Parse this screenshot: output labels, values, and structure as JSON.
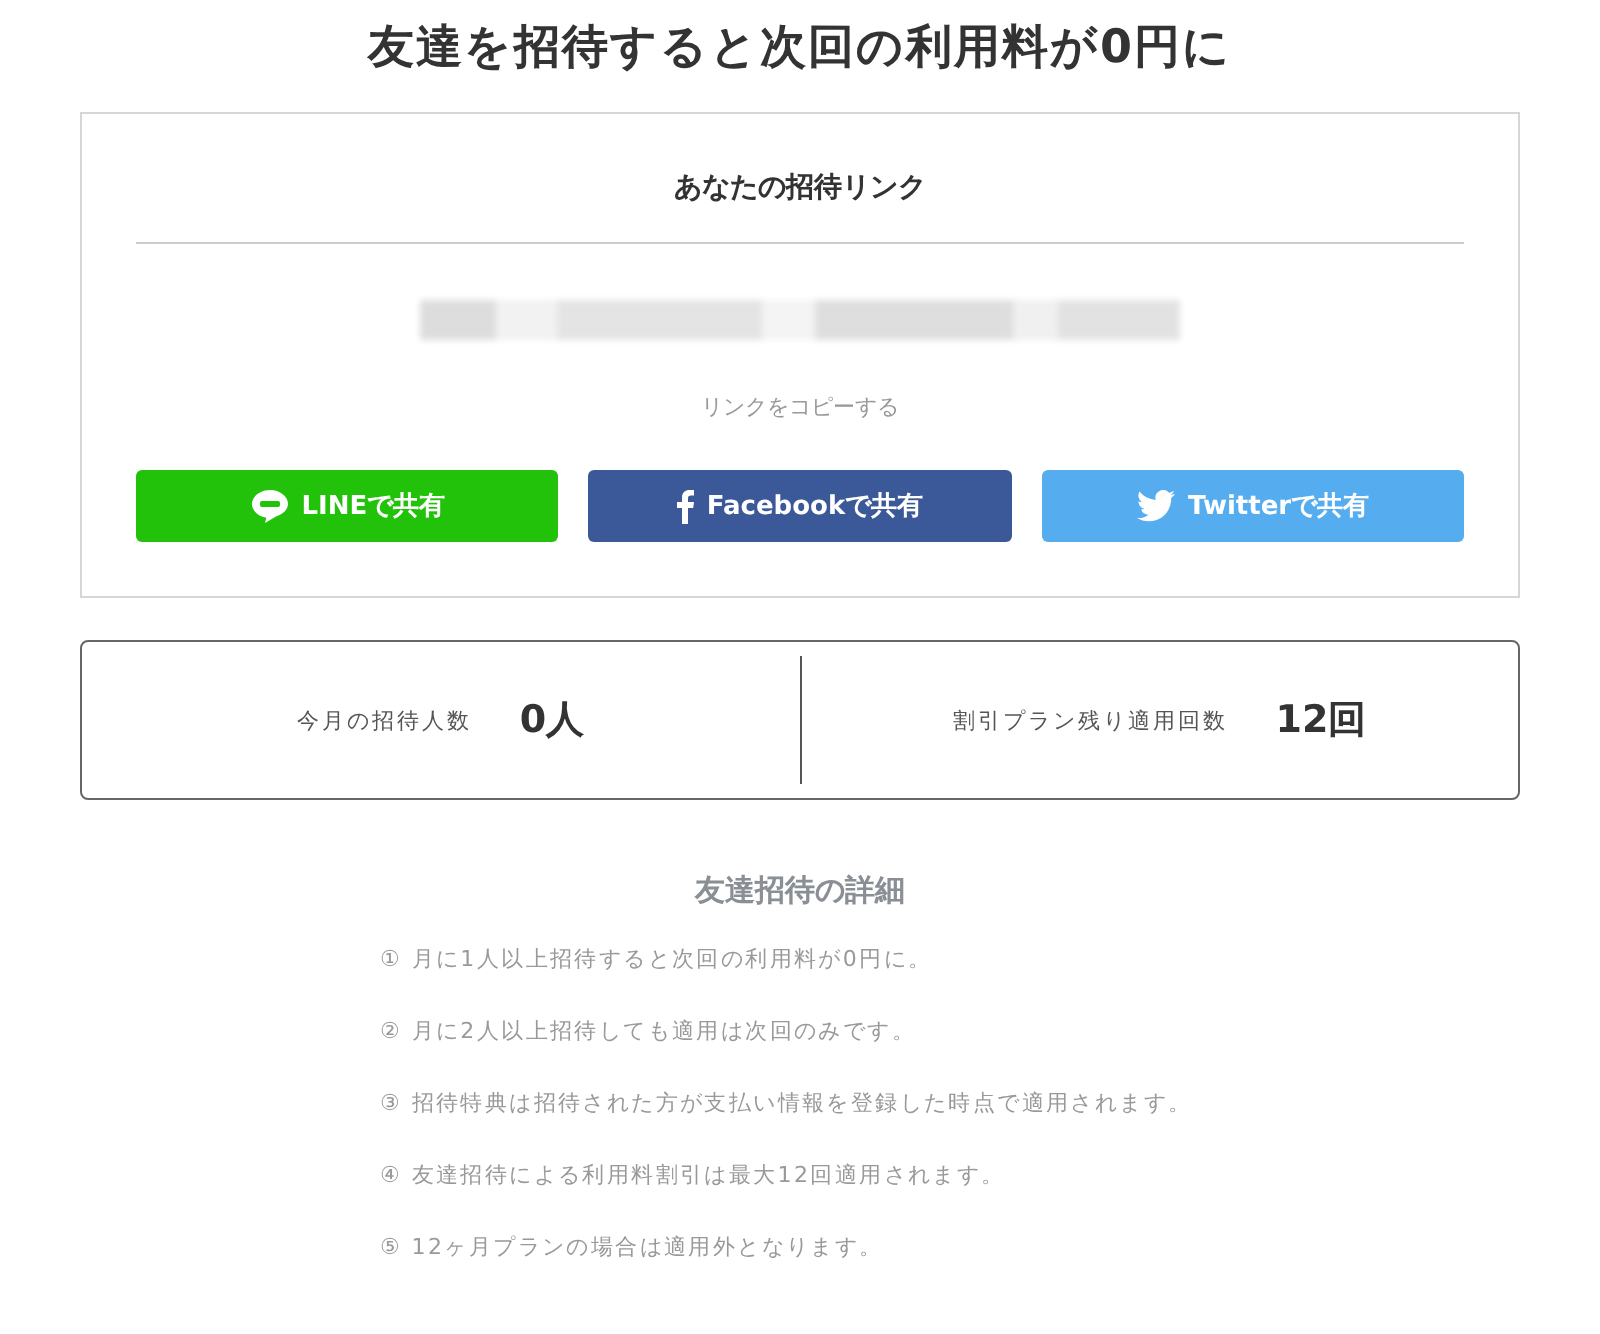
{
  "title": "友達を招待すると次回の利用料が0円に",
  "invite_card": {
    "heading": "あなたの招待リンク",
    "copy_link": "リンクをコピーする",
    "share_buttons": [
      {
        "kind": "line",
        "label": "LINEで共有"
      },
      {
        "kind": "facebook",
        "label": "Facebookで共有"
      },
      {
        "kind": "twitter",
        "label": "Twitterで共有"
      }
    ]
  },
  "stats": [
    {
      "label": "今月の招待人数",
      "value": "0人"
    },
    {
      "label": "割引プラン残り適用回数",
      "value": "12回"
    }
  ],
  "details": {
    "heading": "友達招待の詳細",
    "items": [
      "① 月に1人以上招待すると次回の利用料が0円に。",
      "② 月に2人以上招待しても適用は次回のみです。",
      "③ 招待特典は招待された方が支払い情報を登録した時点で適用されます。",
      "④ 友達招待による利用料割引は最大12回適用されます。",
      "⑤ 12ヶ月プランの場合は適用外となります。"
    ]
  }
}
